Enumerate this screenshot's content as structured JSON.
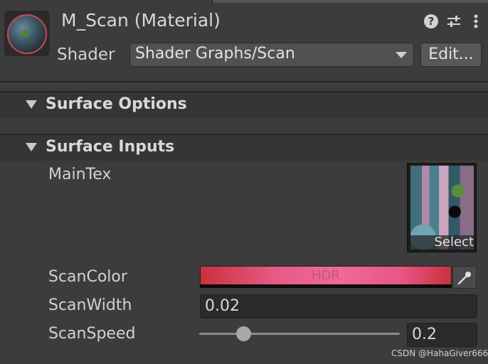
{
  "header": {
    "title": "M_Scan (Material)",
    "shader_label": "Shader",
    "shader_value": "Shader Graphs/Scan",
    "edit_label": "Edit...",
    "icons": [
      "help-icon",
      "sliders-icon",
      "more-vert-icon"
    ]
  },
  "sections": [
    {
      "label": "Surface Options",
      "expanded": true
    },
    {
      "label": "Surface Inputs",
      "expanded": true
    }
  ],
  "properties": {
    "main_tex": {
      "label": "MainTex",
      "select_label": "Select"
    },
    "scan_color": {
      "label": "ScanColor",
      "hdr_label": "HDR",
      "color": "#ef6a95"
    },
    "scan_width": {
      "label": "ScanWidth",
      "value": "0.02"
    },
    "scan_speed": {
      "label": "ScanSpeed",
      "value": "0.2",
      "slider_fraction": 0.22
    }
  },
  "watermark": "CSDN @HahaGiver666"
}
